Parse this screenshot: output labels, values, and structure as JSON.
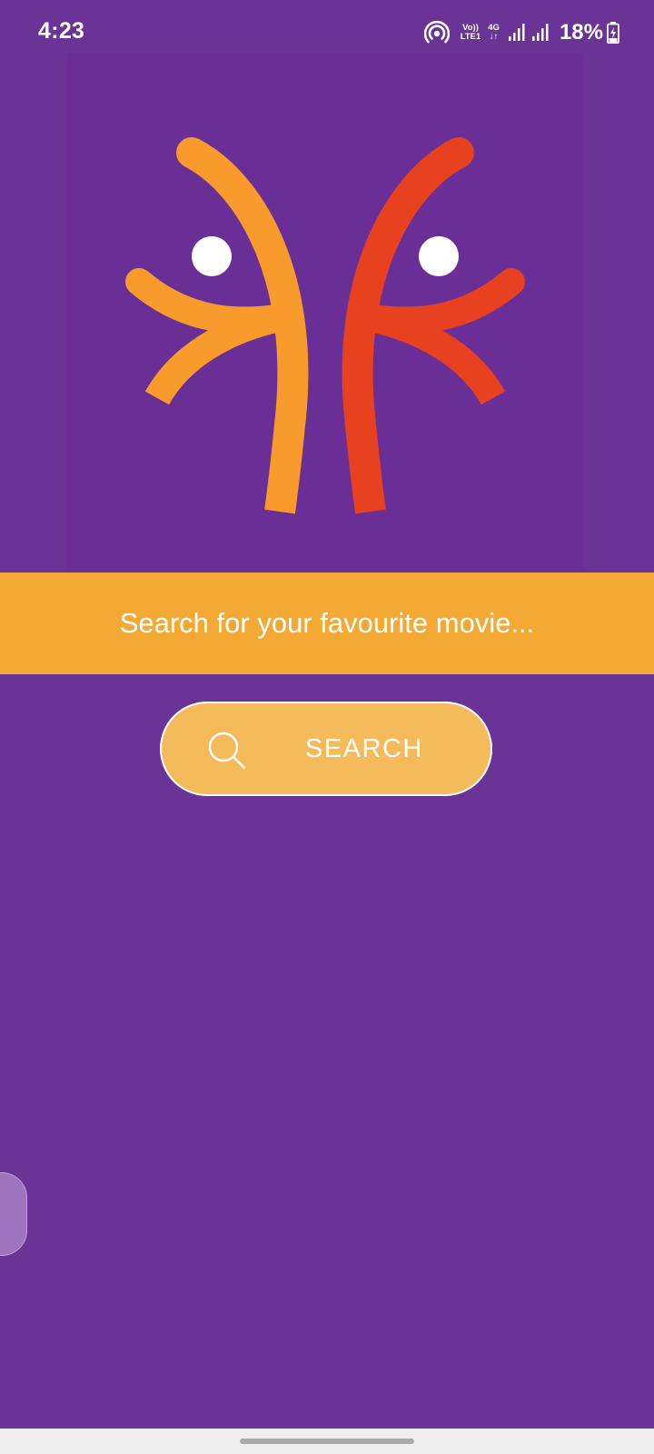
{
  "status_bar": {
    "time": "4:23",
    "volte_top": "Vo))",
    "volte_bottom": "LTE1",
    "network_top": "4G",
    "network_bottom": "↓↑",
    "battery": "18%"
  },
  "logo": {
    "left_color": "#f99b2c",
    "right_color": "#e8411f",
    "head_color": "#ffffff"
  },
  "banner": {
    "text": "Search for your favourite movie...",
    "color": "#f4a935"
  },
  "search_button": {
    "label": "SEARCH",
    "icon": "search-icon",
    "fill": "#f5bb5b"
  },
  "colors": {
    "background": "#6a3496",
    "nav_bar": "#efeff0"
  }
}
